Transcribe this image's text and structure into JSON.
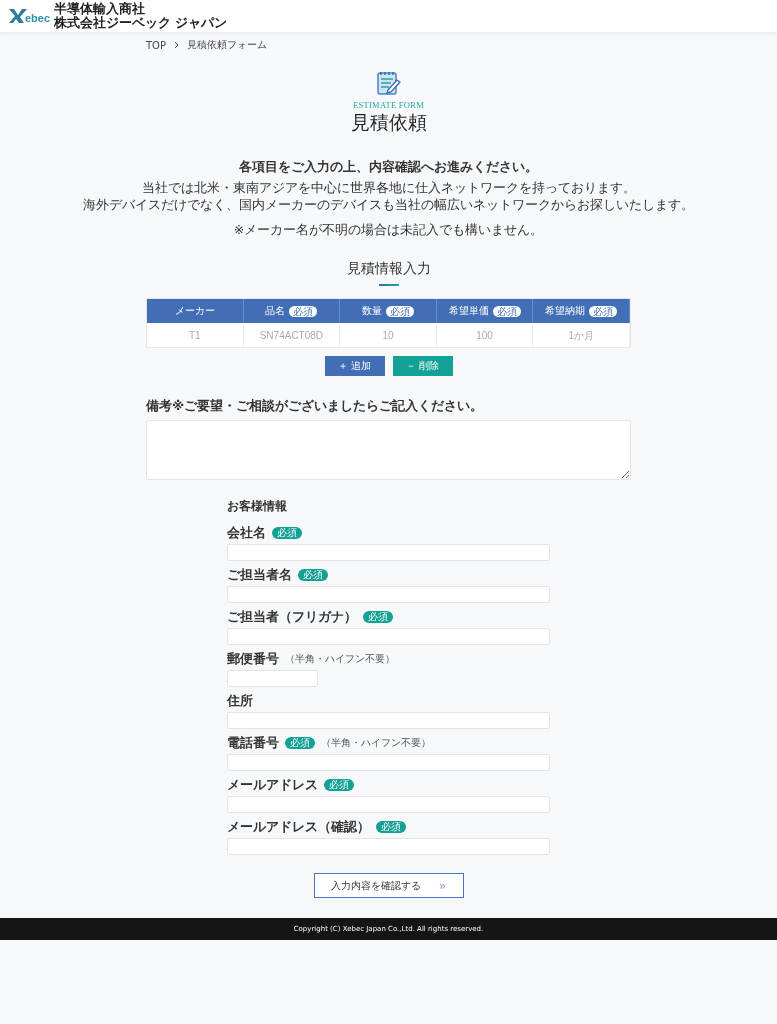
{
  "header": {
    "logo_text": "ebec",
    "company_line_1": "半導体輸入商社",
    "company_line_2": "株式会社ジーベック ジャパン"
  },
  "breadcrumb": [
    {
      "label": "TOP"
    },
    {
      "label": "見積依頼フォーム"
    }
  ],
  "hero": {
    "eyebrow": "ESTIMATE FORM",
    "title": "見積依頼"
  },
  "intro": {
    "lead": "各項目をご入力の上、内容確認へお進みください。",
    "lines": [
      "当社では北米・東南アジアを中心に世界各地に仕入ネットワークを持っております。",
      "海外デバイスだけでなく、国内メーカーのデバイスも当社の幅広いネットワークからお探しいたします。"
    ],
    "note": "※メーカー名が不明の場合は未記入でも構いません。"
  },
  "estimate": {
    "title": "見積情報入力",
    "columns": [
      {
        "label": "メーカー"
      },
      {
        "label": "品名",
        "badge": "必須"
      },
      {
        "label": "数量",
        "badge": "必須"
      },
      {
        "label": "希望単価",
        "badge": "必須"
      },
      {
        "label": "希望納期",
        "badge": "必須"
      }
    ],
    "rows": [
      {
        "placeholders": [
          "T1",
          "SN74ACT08D",
          "10",
          "100",
          "1か月"
        ]
      }
    ],
    "add_button": "＋ 追加",
    "remove_button": "－ 削除"
  },
  "remarks": {
    "label": "備考",
    "hint": "※ご要望・ご相談がございましたらご記入ください。"
  },
  "customer": {
    "title": "お客様情報",
    "fields": [
      {
        "label": "会社名",
        "badge": "必須",
        "kind": "full"
      },
      {
        "label": "ご担当者名",
        "badge": "必須",
        "kind": "full"
      },
      {
        "label": "ご担当者（フリガナ）",
        "badge": "必須",
        "kind": "full"
      },
      {
        "label": "郵便番号",
        "note": "（半角・ハイフン不要）",
        "kind": "short"
      },
      {
        "label": "住所",
        "kind": "full"
      },
      {
        "label": "電話番号",
        "badge": "必須",
        "note": "（半角・ハイフン不要）",
        "kind": "full"
      },
      {
        "label": "メールアドレス",
        "badge": "必須",
        "kind": "full"
      },
      {
        "label": "メールアドレス（確認）",
        "badge": "必須",
        "kind": "full"
      }
    ]
  },
  "confirm_button": {
    "label": "入力内容を確認する",
    "arrow": "»"
  },
  "footer": {
    "copyright": "Copyright (C) Xebec Japan Co.,Ltd. All rights reserved."
  }
}
